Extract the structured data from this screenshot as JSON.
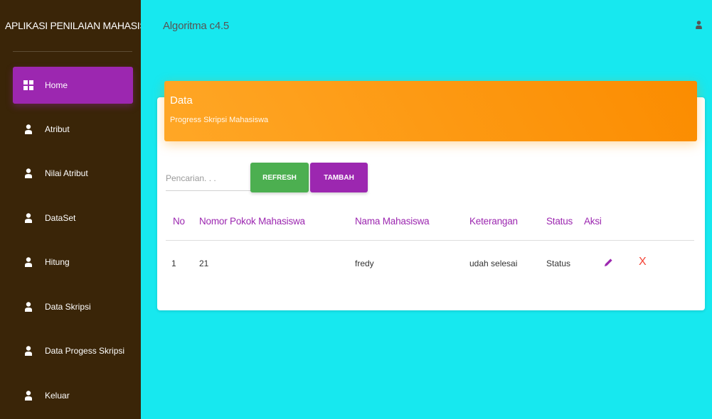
{
  "sidebar": {
    "brand": "APLIKASI PENILAIAN MAHASISWA SKRIPSI",
    "items": [
      {
        "label": "Home",
        "icon": "grid-icon",
        "active": true
      },
      {
        "label": "Atribut",
        "icon": "person-icon"
      },
      {
        "label": "Nilai Atribut",
        "icon": "person-icon"
      },
      {
        "label": "DataSet",
        "icon": "person-icon"
      },
      {
        "label": "Hitung",
        "icon": "person-icon"
      },
      {
        "label": "Data Skripsi",
        "icon": "person-icon"
      },
      {
        "label": "Data Progess Skripsi",
        "icon": "person-icon"
      },
      {
        "label": "Keluar",
        "icon": "person-icon"
      }
    ]
  },
  "topbar": {
    "title": "Algoritma c4.5",
    "user_icon": "person-icon"
  },
  "card": {
    "title": "Data",
    "subtitle": "Progress Skripsi Mahasiswa"
  },
  "toolbar": {
    "search_placeholder": "Pencarian. . .",
    "refresh_label": "REFRESH",
    "add_label": "TAMBAH"
  },
  "table": {
    "headers": [
      "No",
      "Nomor Pokok Mahasiswa",
      "Nama Mahasiswa",
      "Keterangan",
      "Status",
      "Aksi"
    ],
    "rows": [
      {
        "no": "1",
        "npm": "21",
        "nama": "fredy",
        "keterangan": "udah selesai",
        "status": "Status",
        "edit_icon": "pencil-icon",
        "delete_label": "X"
      }
    ]
  },
  "colors": {
    "sidebar_bg": "#3a2508",
    "active_item": "#9c27b0",
    "main_bg": "#17e8ef",
    "header_orange": "#fb8c00",
    "refresh_green": "#4caf50",
    "add_purple": "#9c27b0",
    "delete_red": "#f44336"
  }
}
